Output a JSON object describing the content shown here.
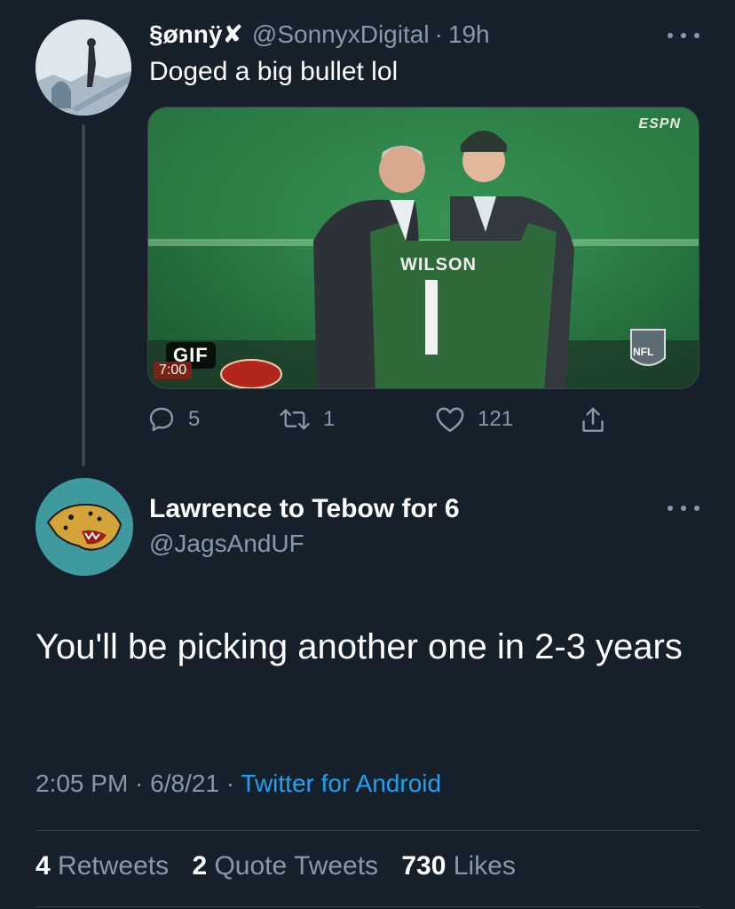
{
  "parent_tweet": {
    "display_name": "§ønnÿ✘",
    "handle": "@SonnyxDigital",
    "separator": "·",
    "time": "19h",
    "text": "Doged a big bullet lol",
    "media": {
      "badge": "GIF",
      "jersey_name": "WILSON",
      "jersey_number": "1",
      "network_logo": "ESPN",
      "league_logo": "NFL",
      "score_time": "7:00"
    },
    "actions": {
      "reply_count": "5",
      "retweet_count": "1",
      "like_count": "121"
    }
  },
  "main_tweet": {
    "display_name": "Lawrence to Tebow for 6",
    "handle": "@JagsAndUF",
    "text": "You'll be picking another one in 2-3 years",
    "time": "2:05 PM · 6/8/21",
    "separator": "·",
    "source": "Twitter for Android",
    "stats": {
      "retweets_count": "4",
      "retweets_label": "Retweets",
      "quotes_count": "2",
      "quotes_label": "Quote Tweets",
      "likes_count": "730",
      "likes_label": "Likes"
    }
  },
  "colors": {
    "background": "#15202b",
    "secondary_text": "#8899a6",
    "link": "#1da1f2",
    "divider": "#38444d"
  },
  "icons": [
    "more-icon",
    "reply-icon",
    "retweet-icon",
    "like-icon",
    "share-icon"
  ]
}
